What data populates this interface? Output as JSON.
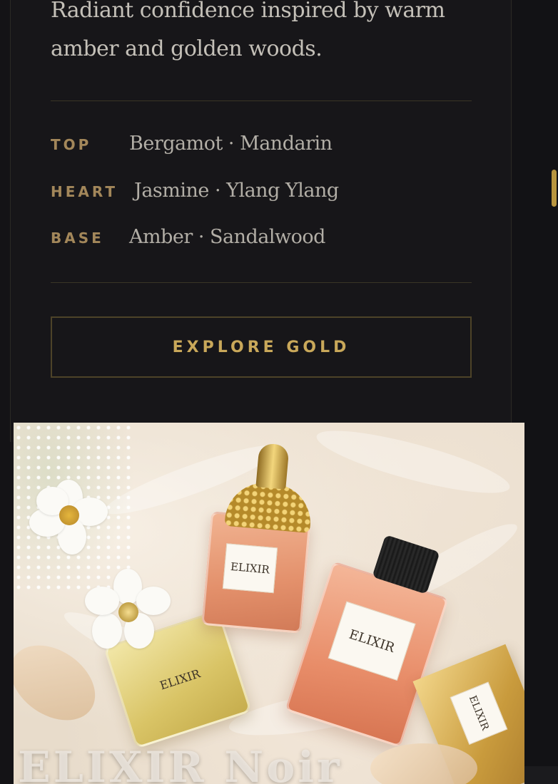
{
  "product": {
    "description": "Radiant confidence inspired by warm amber and golden woods.",
    "notes": [
      {
        "label": "TOP",
        "value": "Bergamot · Mandarin"
      },
      {
        "label": "HEART",
        "value": "Jasmine · Ylang Ylang"
      },
      {
        "label": "BASE",
        "value": "Amber · Sandalwood"
      }
    ],
    "cta_label": "EXPLORE GOLD"
  },
  "image": {
    "bottle_labels": [
      "ELIXIR",
      "ELIXIR",
      "ELIXIR",
      "ELIXIR"
    ],
    "overlay_title": "ELIXIR Noir"
  },
  "colors": {
    "background": "#141316",
    "accent_gold": "#c9a85a",
    "label_gold": "#a3875a",
    "text": "#c4c0b8"
  },
  "icons": {
    "scrollbar": "scrollbar-thumb"
  }
}
